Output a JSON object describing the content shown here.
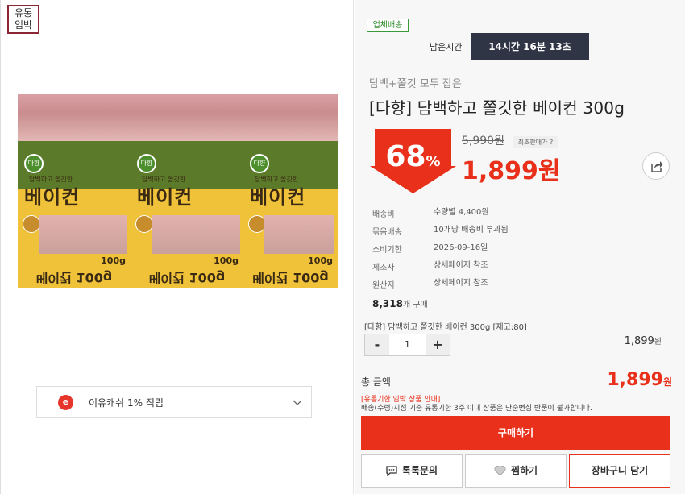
{
  "corner_tag": {
    "line1": "유통",
    "line2": "임박"
  },
  "product_image": {
    "pack_title": "베이컨",
    "pack_sub": "담백하고 쫄깃한",
    "pack_logo": "다향",
    "pack_weight": "100g",
    "pack_bottom": "베이컨 100g"
  },
  "cashback": {
    "icon": "e",
    "text": "이유캐쉬 1% 적립"
  },
  "delivery_badge": "업체배송",
  "timer": {
    "label": "남은시간",
    "value": "14시간 16분 13초"
  },
  "product": {
    "subtitle": "담백+쫄깃 모두 잡은",
    "title": "[다향] 담백하고 쫄깃한 베이컨 300g",
    "discount": "68",
    "discount_unit": "%",
    "original_price": "5,990원",
    "lowest_label": "최초판매가 ?",
    "price": "1,899원"
  },
  "info": [
    {
      "label": "배송비",
      "value": "수량별 4,400원"
    },
    {
      "label": "묶음배송",
      "value": "10개당 배송비 부과됨"
    },
    {
      "label": "소비기한",
      "value": "2026-09-16일"
    },
    {
      "label": "제조사",
      "value": "상세페이지 참조"
    },
    {
      "label": "원산지",
      "value": "상세페이지 참조"
    }
  ],
  "buy_count": {
    "number": "8,318",
    "unit": "개 구매"
  },
  "option": {
    "name": "[다향] 담백하고 쫄깃한 베이컨 300g [재고:80]",
    "minus": "-",
    "qty": "1",
    "plus": "+",
    "price": "1,899",
    "won": "원"
  },
  "total": {
    "label": "총 금액",
    "price": "1,899",
    "won": "원"
  },
  "notice": {
    "title": "[유통기한 임박 상품 안내]",
    "body": "배송(수령)시점 기준 유통기한 3주 이내 상품은 단순변심 반품이 불가합니다."
  },
  "buttons": {
    "buy": "구매하기",
    "inquiry": "톡톡문의",
    "wish": "찜하기",
    "cart": "장바구니 담기"
  },
  "colors": {
    "accent": "#e8301b",
    "timer_bg": "#2f3545",
    "badge_green": "#2f8b2f"
  }
}
